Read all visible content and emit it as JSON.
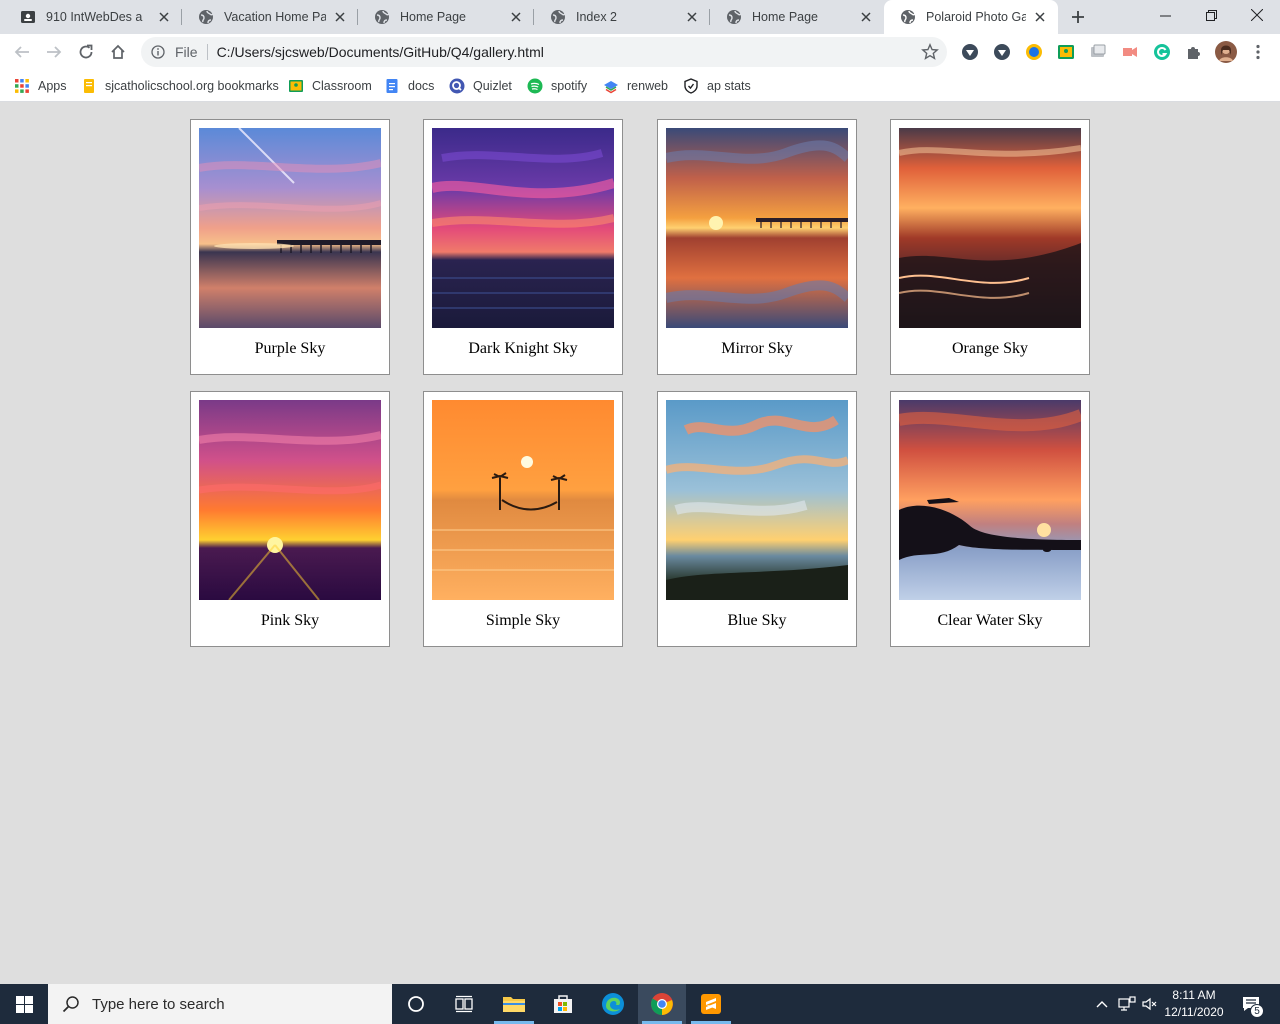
{
  "browser": {
    "tabs": [
      {
        "title": "910 IntWebDes a",
        "icon": "classroom-icon",
        "active": false
      },
      {
        "title": "Vacation Home Page",
        "icon": "globe-icon",
        "active": false
      },
      {
        "title": "Home Page",
        "icon": "globe-icon",
        "active": false
      },
      {
        "title": "Index 2",
        "icon": "globe-icon",
        "active": false
      },
      {
        "title": "Home Page",
        "icon": "globe-icon",
        "active": false
      },
      {
        "title": "Polaroid Photo Gallery",
        "icon": "globe-icon",
        "active": true
      }
    ],
    "address_bar": {
      "scheme_label": "File",
      "url": "C:/Users/sjcsweb/Documents/GitHub/Q4/gallery.html"
    },
    "bookmarks": [
      {
        "label": "Apps",
        "icon": "apps-grid-icon"
      },
      {
        "label": "sjcatholicschool.org bookmarks",
        "icon": "folder-icon"
      },
      {
        "label": "Classroom",
        "icon": "classroom-icon"
      },
      {
        "label": "docs",
        "icon": "docs-icon"
      },
      {
        "label": "Quizlet",
        "icon": "quizlet-icon"
      },
      {
        "label": "spotify",
        "icon": "spotify-icon"
      },
      {
        "label": "renweb",
        "icon": "renweb-icon"
      },
      {
        "label": "ap stats",
        "icon": "shield-icon"
      }
    ]
  },
  "gallery": {
    "photos": [
      {
        "caption": "Purple Sky"
      },
      {
        "caption": "Dark Knight Sky"
      },
      {
        "caption": "Mirror Sky"
      },
      {
        "caption": "Orange Sky"
      },
      {
        "caption": "Pink Sky"
      },
      {
        "caption": "Simple Sky"
      },
      {
        "caption": "Blue Sky"
      },
      {
        "caption": "Clear Water Sky"
      }
    ]
  },
  "taskbar": {
    "search_placeholder": "Type here to search",
    "time": "8:11 AM",
    "date": "12/11/2020",
    "notification_count": "5"
  },
  "colors": {
    "page_background": "#dedede",
    "taskbar": "#1e2b3c",
    "tab_strip": "#dee1e6"
  }
}
